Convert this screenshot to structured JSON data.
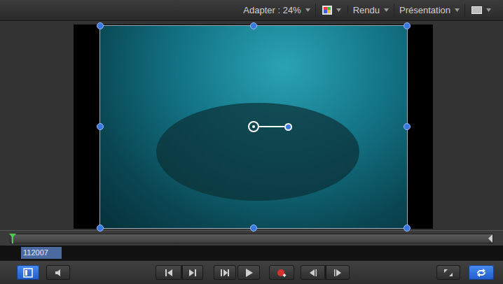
{
  "toolbar": {
    "items": [
      {
        "kind": "text",
        "label": "Adapter : 24%"
      },
      {
        "kind": "color"
      },
      {
        "kind": "text",
        "label": "Rendu"
      },
      {
        "kind": "text",
        "label": "Présentation"
      },
      {
        "kind": "layout"
      }
    ]
  },
  "canvas": {
    "layer": {
      "selected": true
    }
  },
  "timeline": {
    "playhead": 0
  },
  "timecode": "112007",
  "transport": [
    {
      "kind": "layers",
      "active": true
    },
    {
      "kind": "audio",
      "active": false
    },
    {
      "kind": "start",
      "active": false
    },
    {
      "kind": "end",
      "active": false
    },
    {
      "kind": "play-range",
      "active": false
    },
    {
      "kind": "play",
      "active": false
    },
    {
      "kind": "record",
      "active": false
    },
    {
      "kind": "prev-frame",
      "active": false
    },
    {
      "kind": "next-frame",
      "active": false
    },
    {
      "kind": "fullscreen",
      "active": false
    },
    {
      "kind": "loop",
      "active": true
    }
  ]
}
